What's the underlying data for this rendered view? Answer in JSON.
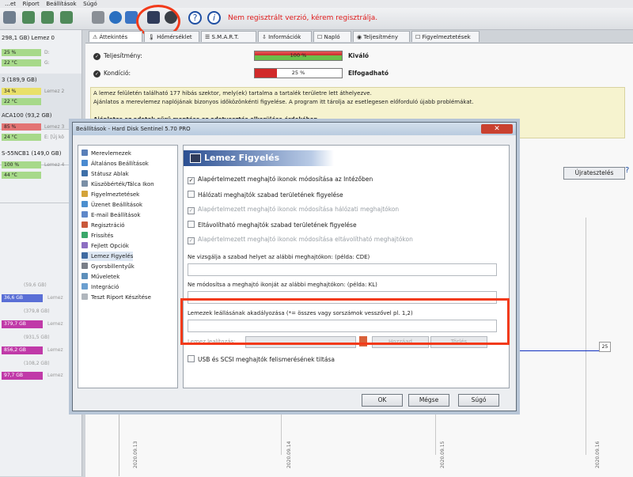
{
  "menu": [
    "…et",
    "Riport",
    "Beállítások",
    "Súgó"
  ],
  "reg_warning": "Nem regisztrált verzió, kérem regisztrálja.",
  "left": {
    "disks": [
      {
        "title": "298,1 GB)  Lemez 0",
        "perf": "25 %",
        "perf_side": "D:",
        "temp": "22 °C",
        "temp_side": "G:"
      },
      {
        "title": "3 (189,9 GB)",
        "perf": "34 %",
        "perf_side": "Lemez 2",
        "temp": "22 °C",
        "temp_side": ""
      },
      {
        "title": "ACA100 (93,2 GB)",
        "perf": "85 %",
        "perf_side": "Lemez 3",
        "temp": "24 °C",
        "temp_side": "E: [Új kö"
      },
      {
        "title": "S-55NCB1 (149,0 GB)",
        "perf": "100 %",
        "perf_side": "Lemez 4",
        "temp": "44 °C",
        "temp_side": ""
      }
    ],
    "volumes": [
      {
        "label": "(59,6 GB)",
        "value": "",
        "side": ""
      },
      {
        "label": "",
        "value": "36,6 GB",
        "side": "Lemez"
      },
      {
        "label": "(379,8 GB)",
        "value": "",
        "side": ""
      },
      {
        "label": "",
        "value": "379,7 GB",
        "side": "Lemez"
      },
      {
        "label": "(931,5 GB)",
        "value": "",
        "side": ""
      },
      {
        "label": "",
        "value": "856,2 GB",
        "side": "Lemez"
      },
      {
        "label": "(108,2 GB)",
        "value": "",
        "side": ""
      },
      {
        "label": "",
        "value": "97,7 GB",
        "side": "Lemez"
      }
    ]
  },
  "tabs": [
    "Áttekintés",
    "Hőmérséklet",
    "S.M.A.R.T.",
    "Információk",
    "Napló",
    "Teljesítmény",
    "Figyelmeztetések"
  ],
  "status": {
    "performance_label": "Teljesítmény:",
    "performance_value": "100 %",
    "performance_pct": 100,
    "performance_rating": "Kiváló",
    "condition_label": "Kondíció:",
    "condition_value": "25 %",
    "condition_pct": 25,
    "condition_rating": "Elfogadható"
  },
  "info_lines": [
    "A lemez felületén található 177 hibás szektor, mely(ek) tartalma a tartalék területre lett áthelyezve.",
    "Ajánlatos a merevlemez naplójának bizonyos időközönkénti figyelése. A program itt tárolja az esetlegesen előforduló újabb problémákat.",
    "",
    "Ajánlatos az adatok sűrű mentése az adatvesztés elkerülése érdekében."
  ],
  "reset_button": "Újratesztelés",
  "graph": {
    "x_labels": [
      "2020.09.13",
      "2020.09.14",
      "2020.09.15",
      "2020.09.16"
    ],
    "value_badge": "25"
  },
  "dialog": {
    "title": "Beállítások  -  Hard Disk Sentinel 5.70 PRO",
    "close": "✕",
    "tree": [
      "Merevlemezek",
      "Általános Beállítások",
      "Státusz Ablak",
      "Küszöbérték/Tálca Ikon",
      "Figyelmeztetések",
      "Üzenet Beállítások",
      "E-mail Beállítások",
      "Regisztráció",
      "Frissítés",
      "Fejlett Opciók",
      "Lemez Figyelés",
      "Gyorsbillentyűk",
      "Műveletek",
      "Integráció",
      "Teszt Riport Készítése"
    ],
    "tree_selected": 10,
    "heading": "Lemez Figyelés",
    "checks": [
      {
        "label": "Alapértelmezett meghajtó ikonok módosítása az Intézőben",
        "checked": true,
        "disabled": false
      },
      {
        "label": "Hálózati meghajtók szabad területének figyelése",
        "checked": false,
        "disabled": false
      },
      {
        "label": "Alapértelmezett meghajtó ikonok módosítása hálózati meghajtókon",
        "checked": true,
        "disabled": true
      },
      {
        "label": "Eltávolítható meghajtók szabad területének figyelése",
        "checked": false,
        "disabled": false
      },
      {
        "label": "Alapértelmezett meghajtó ikonok módosítása eltávolítható meghajtókon",
        "checked": true,
        "disabled": true
      }
    ],
    "field1_label": "Ne vizsgálja a szabad helyet az alábbi meghajtókon: (példa: CDE)",
    "field2_label": "Ne módosítsa a meghajtó ikonját az alábbi meghajtókon: (példa: KL)",
    "field3_label": "Lemezek leállásának akadályozása (*= összes vagy sorszámok vesszővel pl. 1,2)",
    "blurred_label": "Lemez lealítozás:",
    "blurred_btn1": "Hozzáad",
    "blurred_btn2": "Törlés",
    "usb_check": "USB és SCSI meghajtók felismerésének tiltása",
    "ok": "OK",
    "cancel": "Mégse",
    "help": "Súgó"
  }
}
